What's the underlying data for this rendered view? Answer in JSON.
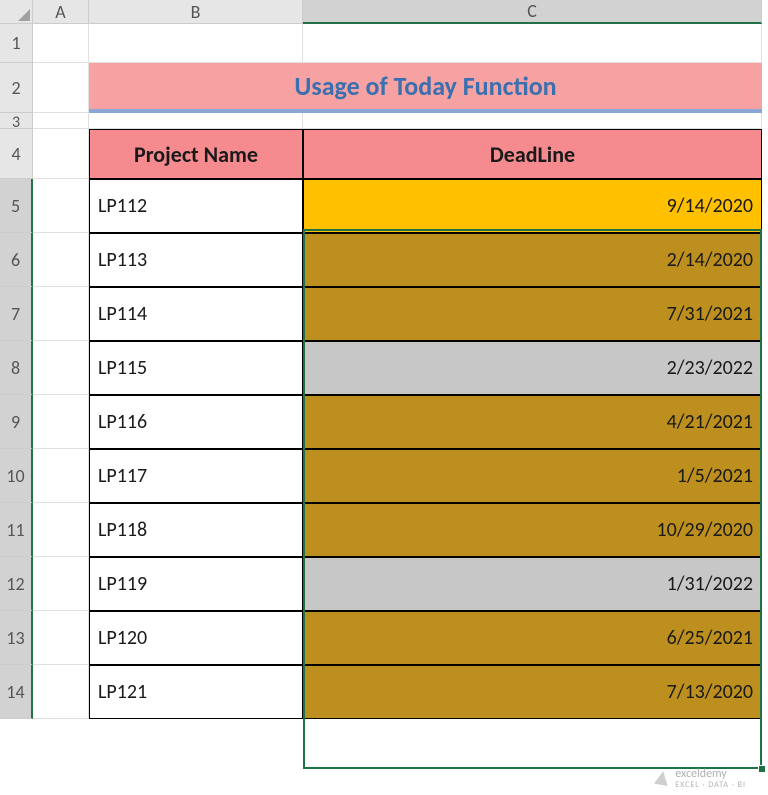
{
  "columns": {
    "A": "A",
    "B": "B",
    "C": "C"
  },
  "rows": [
    "1",
    "2",
    "3",
    "4",
    "5",
    "6",
    "7",
    "8",
    "9",
    "10",
    "11",
    "12",
    "13",
    "14"
  ],
  "title": "Usage of Today Function",
  "headers": {
    "project": "Project Name",
    "deadline": "DeadLine"
  },
  "data": [
    {
      "name": "LP112",
      "deadline": "9/14/2020",
      "fill": "bright-yellow"
    },
    {
      "name": "LP113",
      "deadline": "2/14/2020",
      "fill": "dark-yellow"
    },
    {
      "name": "LP114",
      "deadline": "7/31/2021",
      "fill": "dark-yellow"
    },
    {
      "name": "LP115",
      "deadline": "2/23/2022",
      "fill": "grey"
    },
    {
      "name": "LP116",
      "deadline": "4/21/2021",
      "fill": "dark-yellow"
    },
    {
      "name": "LP117",
      "deadline": "1/5/2021",
      "fill": "dark-yellow"
    },
    {
      "name": "LP118",
      "deadline": "10/29/2020",
      "fill": "dark-yellow"
    },
    {
      "name": "LP119",
      "deadline": "1/31/2022",
      "fill": "grey"
    },
    {
      "name": "LP120",
      "deadline": "6/25/2021",
      "fill": "dark-yellow"
    },
    {
      "name": "LP121",
      "deadline": "7/13/2020",
      "fill": "dark-yellow"
    }
  ],
  "watermark": {
    "name": "exceldemy",
    "tagline": "EXCEL · DATA · BI"
  },
  "chart_data": {
    "type": "table",
    "title": "Usage of Today Function",
    "columns": [
      "Project Name",
      "DeadLine"
    ],
    "rows": [
      [
        "LP112",
        "9/14/2020"
      ],
      [
        "LP113",
        "2/14/2020"
      ],
      [
        "LP114",
        "7/31/2021"
      ],
      [
        "LP115",
        "2/23/2022"
      ],
      [
        "LP116",
        "4/21/2021"
      ],
      [
        "LP117",
        "1/5/2021"
      ],
      [
        "LP118",
        "10/29/2020"
      ],
      [
        "LP119",
        "1/31/2022"
      ],
      [
        "LP120",
        "6/25/2021"
      ],
      [
        "LP121",
        "7/13/2020"
      ]
    ]
  }
}
